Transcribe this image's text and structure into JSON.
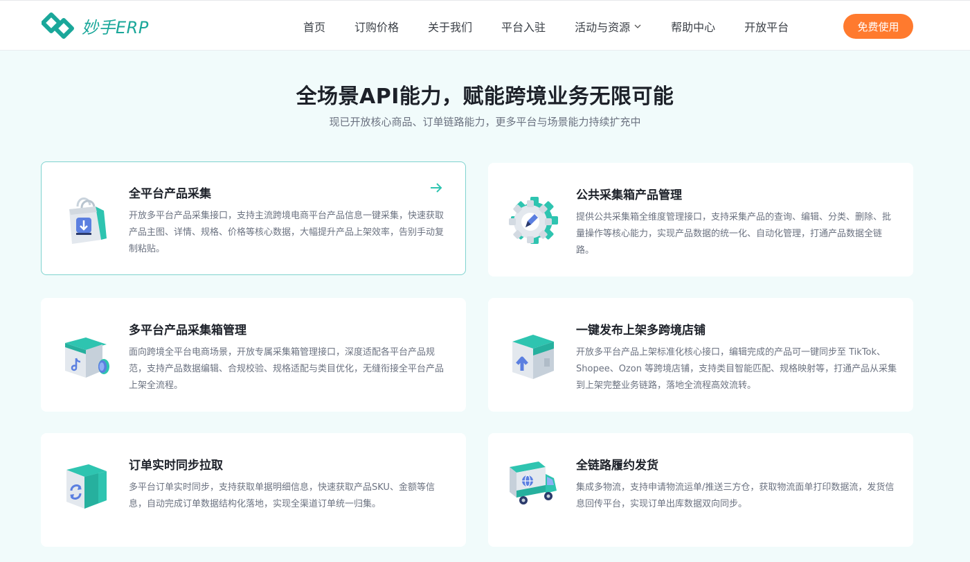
{
  "brand": {
    "name": "妙手ERP",
    "accent": "#1aa79a",
    "cta_color": "#ff7a2e"
  },
  "nav": {
    "items": [
      {
        "label": "首页"
      },
      {
        "label": "订购价格"
      },
      {
        "label": "关于我们"
      },
      {
        "label": "平台入驻"
      },
      {
        "label": "活动与资源",
        "has_dropdown": true
      },
      {
        "label": "帮助中心"
      },
      {
        "label": "开放平台"
      }
    ],
    "cta_label": "免费使用"
  },
  "hero": {
    "title": "全场景API能力，赋能跨境业务无限可能",
    "subtitle": "现已开放核心商品、订单链路能力，更多平台与场景能力持续扩充中"
  },
  "cards": [
    {
      "title": "全平台产品采集",
      "desc": "开放多平台产品采集接口，支持主流跨境电商平台产品信息一键采集，快速获取产品主图、详情、规格、价格等核心数据，大幅提升产品上架效率，告别手动复制粘贴。",
      "icon": "shopping-bag-download-icon",
      "active": true
    },
    {
      "title": "公共采集箱产品管理",
      "desc": "提供公共采集箱全维度管理接口，支持采集产品的查询、编辑、分类、删除、批量操作等核心能力，实现产品数据的统一化、自动化管理，打通产品数据全链路。",
      "icon": "gear-edit-icon"
    },
    {
      "title": "多平台产品采集箱管理",
      "desc": "面向跨境全平台电商场景，开放专属采集箱管理接口，深度适配各平台产品规范，支持产品数据编辑、合规校验、规格适配与类目优化，无缝衔接全平台产品上架全流程。",
      "icon": "tiktok-box-icon"
    },
    {
      "title": "一键发布上架多跨境店铺",
      "desc": "开放多平台产品上架标准化核心接口，编辑完成的产品可一键同步至 TikTok、Shopee、Ozon 等跨境店铺，支持类目智能匹配、规格映射等，打通产品从采集到上架完整业务链路，落地全流程高效流转。",
      "icon": "upload-box-icon"
    },
    {
      "title": "订单实时同步拉取",
      "desc": "多平台订单实时同步，支持获取单据明细信息，快速获取产品SKU、金额等信息，自动完成订单数据结构化落地，实现全渠道订单统一归集。",
      "icon": "sync-box-icon"
    },
    {
      "title": "全链路履约发货",
      "desc": "集成多物流，支持申请物流运单/推送三方仓，获取物流面单打印数据流，发货信息回传平台，实现订单出库数据双向同步。",
      "icon": "delivery-truck-icon"
    }
  ]
}
